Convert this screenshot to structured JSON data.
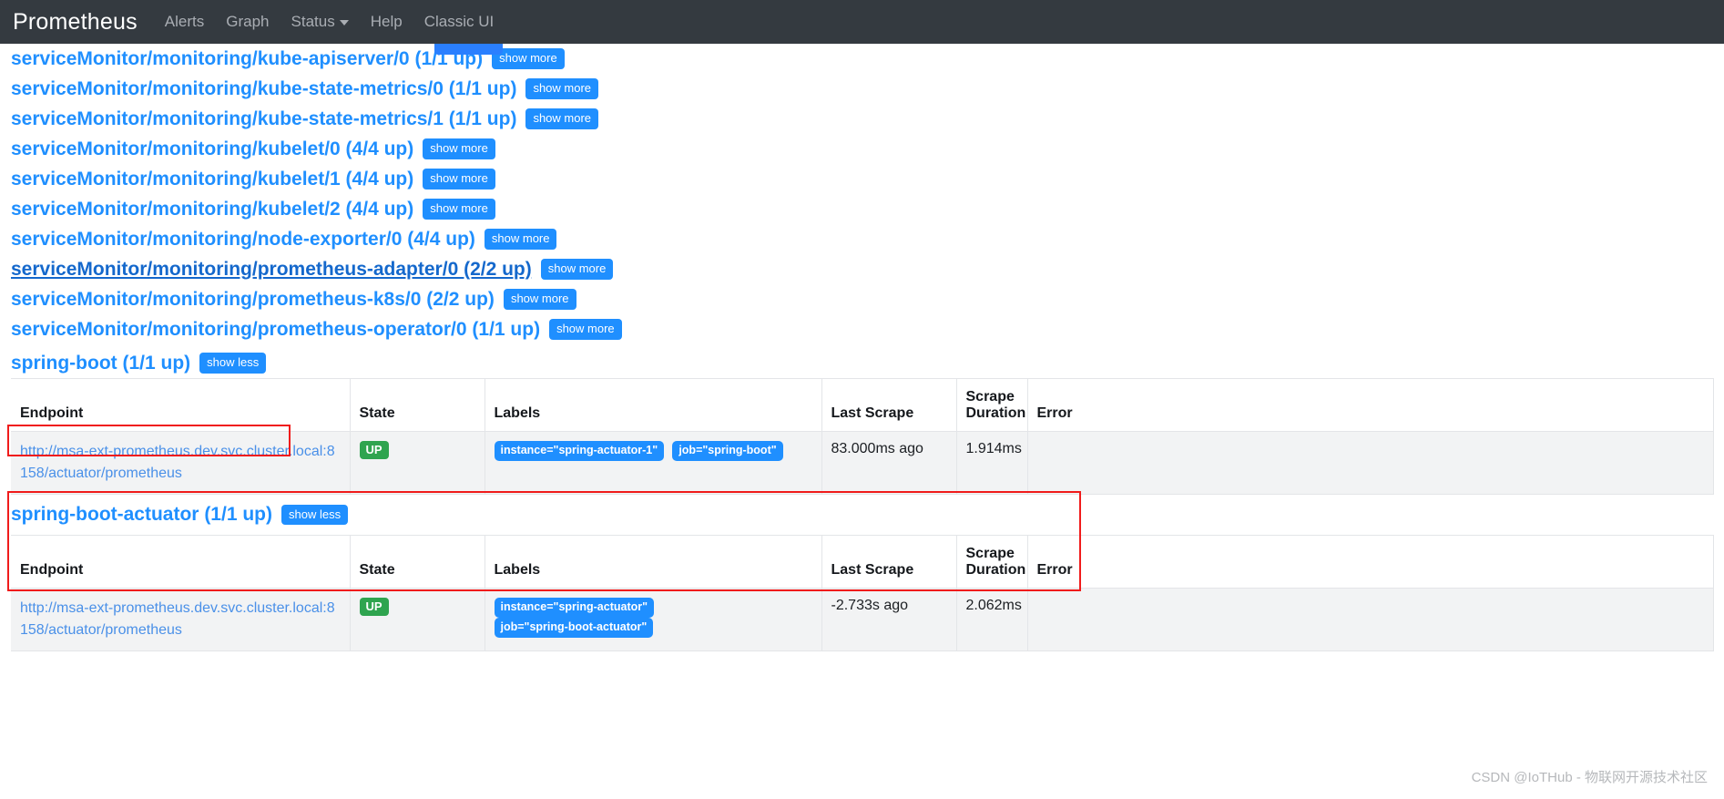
{
  "navbar": {
    "brand": "Prometheus",
    "items": [
      {
        "label": "Alerts",
        "icon": ""
      },
      {
        "label": "Graph",
        "icon": ""
      },
      {
        "label": "Status",
        "icon": "caret-down-icon"
      },
      {
        "label": "Help",
        "icon": ""
      },
      {
        "label": "Classic UI",
        "icon": ""
      }
    ]
  },
  "targets": [
    {
      "title": "serviceMonitor/monitoring/kube-apiserver/0 (1/1 up)",
      "button": "show more",
      "hovered": false
    },
    {
      "title": "serviceMonitor/monitoring/kube-state-metrics/0 (1/1 up)",
      "button": "show more",
      "hovered": false
    },
    {
      "title": "serviceMonitor/monitoring/kube-state-metrics/1 (1/1 up)",
      "button": "show more",
      "hovered": false
    },
    {
      "title": "serviceMonitor/monitoring/kubelet/0 (4/4 up)",
      "button": "show more",
      "hovered": false
    },
    {
      "title": "serviceMonitor/monitoring/kubelet/1 (4/4 up)",
      "button": "show more",
      "hovered": false
    },
    {
      "title": "serviceMonitor/monitoring/kubelet/2 (4/4 up)",
      "button": "show more",
      "hovered": false
    },
    {
      "title": "serviceMonitor/monitoring/node-exporter/0 (4/4 up)",
      "button": "show more",
      "hovered": false
    },
    {
      "title": "serviceMonitor/monitoring/prometheus-adapter/0 (2/2 up)",
      "button": "show more",
      "hovered": true
    },
    {
      "title": "serviceMonitor/monitoring/prometheus-k8s/0 (2/2 up)",
      "button": "show more",
      "hovered": false
    },
    {
      "title": "serviceMonitor/monitoring/prometheus-operator/0 (1/1 up)",
      "button": "show more",
      "hovered": false
    }
  ],
  "expanded": [
    {
      "title": "spring-boot (1/1 up)",
      "button": "show less",
      "columns": [
        "Endpoint",
        "State",
        "Labels",
        "Last Scrape",
        "Scrape Duration",
        "Error"
      ],
      "rows": [
        {
          "endpoint": "http://msa-ext-prometheus.dev.svc.cluster.local:8158/actuator/prometheus",
          "state": "UP",
          "labels": [
            "instance=\"spring-actuator-1\"",
            "job=\"spring-boot\""
          ],
          "last_scrape": "83.000ms ago",
          "scrape_duration": "1.914ms",
          "error": ""
        }
      ]
    },
    {
      "title": "spring-boot-actuator (1/1 up)",
      "button": "show less",
      "columns": [
        "Endpoint",
        "State",
        "Labels",
        "Last Scrape",
        "Scrape Duration",
        "Error"
      ],
      "rows": [
        {
          "endpoint": "http://msa-ext-prometheus.dev.svc.cluster.local:8158/actuator/prometheus",
          "state": "UP",
          "labels": [
            "instance=\"spring-actuator\"",
            "job=\"spring-boot-actuator\""
          ],
          "last_scrape": "-2.733s ago",
          "scrape_duration": "2.062ms",
          "error": ""
        }
      ]
    }
  ],
  "watermark": "CSDN @IoTHub - 物联网开源技术社区",
  "colors": {
    "navbar_bg": "#343a40",
    "link_blue": "#1f8fff",
    "badge_up_green": "#2fa44f",
    "annotation_red": "#f01b1b"
  }
}
